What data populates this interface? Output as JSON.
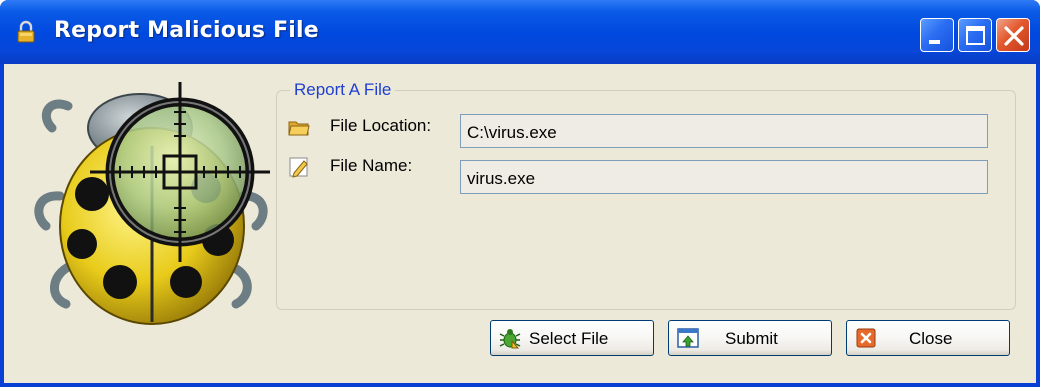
{
  "window": {
    "title": "Report Malicious File",
    "title_icon": "lock-icon",
    "controls": [
      {
        "name": "minimize-button",
        "icon": "minimize-icon"
      },
      {
        "name": "maximize-button",
        "icon": "maximize-icon"
      },
      {
        "name": "close-window-button",
        "icon": "close-icon"
      }
    ]
  },
  "illustration": {
    "icon": "ladybug-crosshair-icon"
  },
  "group": {
    "legend": "Report A File",
    "fields": {
      "location": {
        "label": "File Location:",
        "value": "C:\\virus.exe",
        "icon": "folder-icon"
      },
      "name": {
        "label": "File Name:",
        "value": "virus.exe",
        "icon": "edit-icon"
      }
    }
  },
  "buttons": {
    "select_file": {
      "label": "Select File",
      "icon": "bug-icon"
    },
    "submit": {
      "label": "Submit",
      "icon": "upload-icon"
    },
    "close": {
      "label": "Close",
      "icon": "close-icon"
    }
  },
  "colors": {
    "titlebar": "#0048df",
    "client_bg": "#ece9d8",
    "legend_text": "#1f3fd0",
    "close_accent": "#e3582d"
  }
}
